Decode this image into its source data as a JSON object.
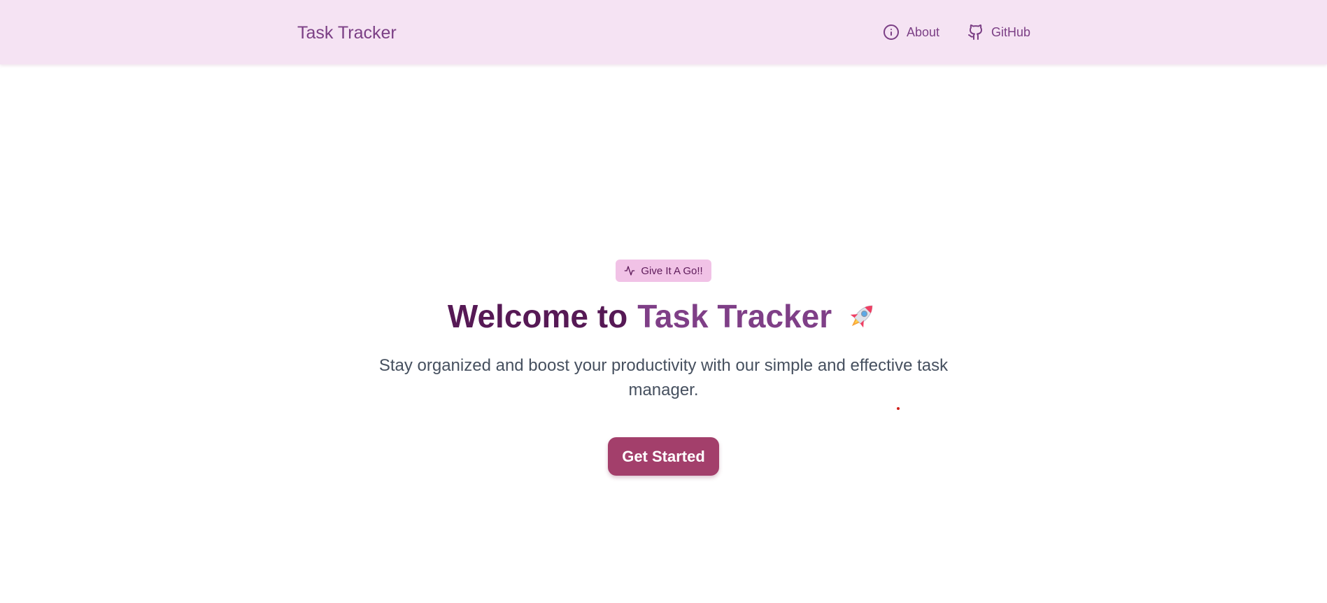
{
  "nav": {
    "brand": "Task Tracker",
    "links": [
      {
        "label": "About",
        "icon": "info-circle-icon"
      },
      {
        "label": "GitHub",
        "icon": "github-icon"
      }
    ]
  },
  "hero": {
    "badge": {
      "label": "Give It A Go!!",
      "icon": "activity-icon"
    },
    "headline_prefix": "Welcome to",
    "headline_accent": "Task Tracker",
    "headline_emoji_icon": "rocket-icon",
    "subtitle": "Stay organized and boost your productivity with our simple and effective task manager.",
    "cta_label": "Get Started"
  },
  "colors": {
    "navbar_bg": "#f5e3f3",
    "brand": "#7b3f85",
    "headline": "#561955",
    "headline_accent": "#7f3f87",
    "badge_bg": "#f1c2e6",
    "cta_bg": "#a33f6b",
    "subtitle": "#46505f"
  }
}
